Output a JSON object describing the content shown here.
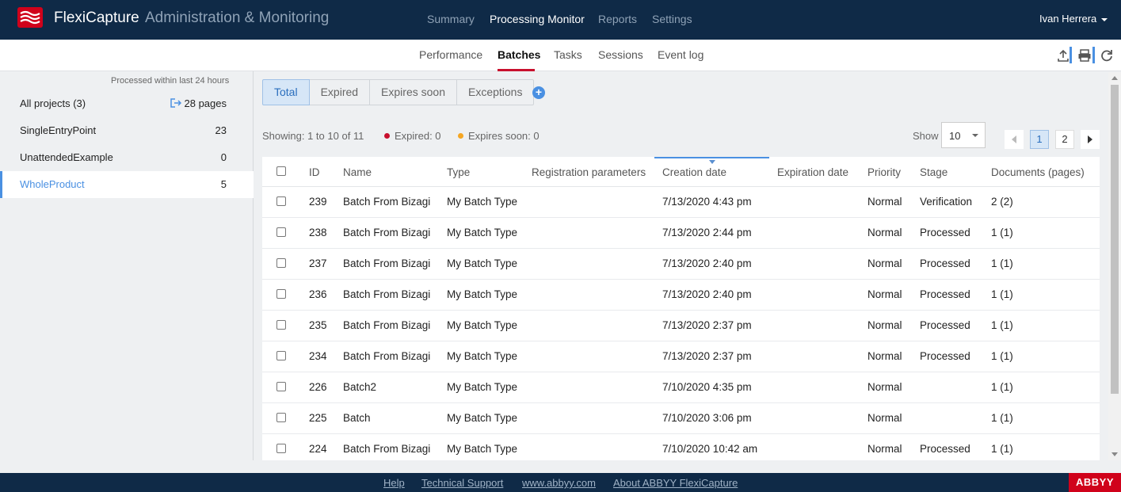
{
  "header": {
    "brand": "FlexiCapture",
    "subtitle": "Administration & Monitoring",
    "nav": [
      "Summary",
      "Processing Monitor",
      "Reports",
      "Settings"
    ],
    "active_nav": "Processing Monitor",
    "user": "Ivan Herrera"
  },
  "subnav": {
    "items": [
      "Performance",
      "Batches",
      "Tasks",
      "Sessions",
      "Event log"
    ],
    "active": "Batches",
    "tools": [
      "export-icon",
      "print-icon",
      "refresh-icon"
    ]
  },
  "sidebar": {
    "note": "Processed within last 24 hours",
    "projects": [
      {
        "name": "All projects (3)",
        "count": "28 pages"
      },
      {
        "name": "SingleEntryPoint",
        "count": "23"
      },
      {
        "name": "UnattendedExample",
        "count": "0"
      },
      {
        "name": "WholeProduct",
        "count": "5",
        "selected": true
      }
    ]
  },
  "filters": {
    "tabs": [
      "Total",
      "Expired",
      "Expires soon",
      "Exceptions"
    ],
    "active": "Total"
  },
  "summary": {
    "showing": "Showing: 1 to 10 of 11",
    "expired": "Expired: 0",
    "expires_soon": "Expires soon: 0",
    "show_label": "Show",
    "page_size": "10",
    "pages": [
      "1",
      "2"
    ],
    "current_page": "1"
  },
  "colors": {
    "header_bg": "#0f2a47",
    "accent": "#4a90e2",
    "active_underline": "#c8102e",
    "expired_dot": "#c8102e",
    "expires_soon_dot": "#f5a623",
    "abbyy_red": "#d0021b"
  },
  "table": {
    "columns": [
      "ID",
      "Name",
      "Type",
      "Registration parameters",
      "Creation date",
      "Expiration date",
      "Priority",
      "Stage",
      "Documents (pages)"
    ],
    "sorted_by": "Creation date",
    "rows": [
      {
        "id": "239",
        "name": "Batch From Bizagi",
        "type": "My Batch Type",
        "reg": "",
        "created": "7/13/2020 4:43 pm",
        "expires": "",
        "priority": "Normal",
        "stage": "Verification",
        "docs": "2 (2)"
      },
      {
        "id": "238",
        "name": "Batch From Bizagi",
        "type": "My Batch Type",
        "reg": "",
        "created": "7/13/2020 2:44 pm",
        "expires": "",
        "priority": "Normal",
        "stage": "Processed",
        "docs": "1 (1)"
      },
      {
        "id": "237",
        "name": "Batch From Bizagi",
        "type": "My Batch Type",
        "reg": "",
        "created": "7/13/2020 2:40 pm",
        "expires": "",
        "priority": "Normal",
        "stage": "Processed",
        "docs": "1 (1)"
      },
      {
        "id": "236",
        "name": "Batch From Bizagi",
        "type": "My Batch Type",
        "reg": "",
        "created": "7/13/2020 2:40 pm",
        "expires": "",
        "priority": "Normal",
        "stage": "Processed",
        "docs": "1 (1)"
      },
      {
        "id": "235",
        "name": "Batch From Bizagi",
        "type": "My Batch Type",
        "reg": "",
        "created": "7/13/2020 2:37 pm",
        "expires": "",
        "priority": "Normal",
        "stage": "Processed",
        "docs": "1 (1)"
      },
      {
        "id": "234",
        "name": "Batch From Bizagi",
        "type": "My Batch Type",
        "reg": "",
        "created": "7/13/2020 2:37 pm",
        "expires": "",
        "priority": "Normal",
        "stage": "Processed",
        "docs": "1 (1)"
      },
      {
        "id": "226",
        "name": "Batch2",
        "type": "My Batch Type",
        "reg": "",
        "created": "7/10/2020 4:35 pm",
        "expires": "",
        "priority": "Normal",
        "stage": "",
        "docs": "1 (1)"
      },
      {
        "id": "225",
        "name": "Batch",
        "type": "My Batch Type",
        "reg": "",
        "created": "7/10/2020 3:06 pm",
        "expires": "",
        "priority": "Normal",
        "stage": "",
        "docs": "1 (1)"
      },
      {
        "id": "224",
        "name": "Batch From Bizagi",
        "type": "My Batch Type",
        "reg": "",
        "created": "7/10/2020 10:42 am",
        "expires": "",
        "priority": "Normal",
        "stage": "Processed",
        "docs": "1 (1)"
      }
    ]
  },
  "footer": {
    "links": [
      "Help",
      "Technical Support",
      "www.abbyy.com",
      "About ABBYY FlexiCapture"
    ],
    "logo": "ABBYY"
  }
}
